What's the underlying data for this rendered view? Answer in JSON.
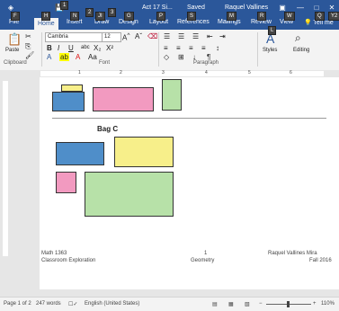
{
  "window": {
    "doc_title": "Act 17 Si...",
    "save_state": "Saved",
    "user": "Raquel Vallines"
  },
  "keytips": {
    "quick_save": "1",
    "quick_2": "2",
    "quick_3": "3",
    "file": "F",
    "home": "H",
    "insert": "N",
    "draw": "JI",
    "design": "G",
    "layout": "P",
    "references": "S",
    "mailings": "M",
    "review": "R",
    "view": "W",
    "tellme": "Q",
    "share": "Y2"
  },
  "tabs": [
    "File",
    "Home",
    "Insert",
    "Draw",
    "Design",
    "Layout",
    "References",
    "Mailings",
    "Review",
    "View"
  ],
  "tell_me": "Tell me",
  "ribbon": {
    "paste": "Paste",
    "clipboard": "Clipboard",
    "font_name": "Cambria",
    "font_size": "12",
    "font_group": "Font",
    "paragraph_group": "Paragraph",
    "styles": "Styles",
    "editing": "Editing"
  },
  "ruler_numbers": [
    "1",
    "2",
    "3",
    "4",
    "5",
    "6"
  ],
  "document": {
    "bag_c_label": "Bag C",
    "footer_left_line1": "Math 1363",
    "footer_left_line2": "Classroom Exploration",
    "footer_center_page": "1",
    "footer_center_subject": "Geometry",
    "footer_right_line1": "Raquel Vallines Mira",
    "footer_right_line2": "Fall 2016"
  },
  "colors": {
    "word_blue": "#2b579a",
    "yellow": "#f7ef8a",
    "blue": "#4f8ec9",
    "pink": "#f29ac0",
    "green": "#b7e1a8"
  },
  "status": {
    "page": "Page 1 of 2",
    "words": "247 words",
    "language": "English (United States)",
    "zoom": "110%"
  }
}
